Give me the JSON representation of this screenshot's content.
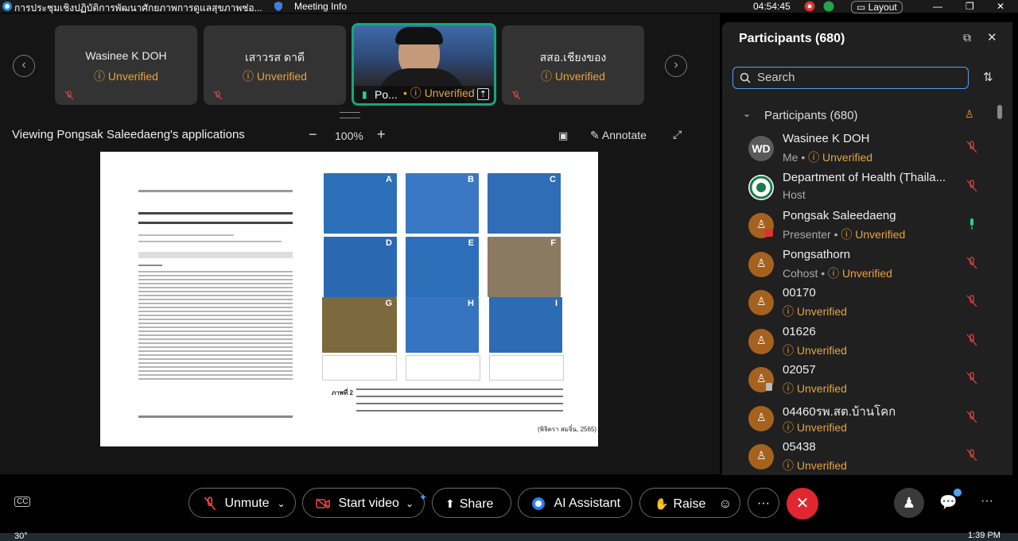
{
  "titlebar": {
    "meeting_title": "การประชุมเชิงปฏิบัติการพัฒนาศักยภาพการดูแลสุขภาพช่อ...",
    "meeting_info": "Meeting Info",
    "time": "04:54:45",
    "layout": "Layout"
  },
  "tiles": [
    {
      "name": "Wasinee K DOH",
      "status": "Unverified"
    },
    {
      "name": "เสาวรส ดาดี",
      "status": "Unverified"
    },
    {
      "name": "Po...",
      "status": "Unverified"
    },
    {
      "name": "สสอ.เชียงของ",
      "status": "Unverified"
    }
  ],
  "share": {
    "viewing": "Viewing Pongsak Saleedaeng's applications",
    "zoom": "100%",
    "annotate": "Annotate"
  },
  "doc": {
    "picture_labels": [
      "A",
      "B",
      "C",
      "D",
      "E",
      "F",
      "G",
      "H",
      "I"
    ],
    "caption_bottom": "(พิจิตรา สมจิ๋น, 2565)",
    "figure_label": "ภาพที่ 2"
  },
  "panel": {
    "title": "Participants (680)",
    "search_placeholder": "Search",
    "section": "Participants (680)",
    "participants": [
      {
        "name": "Wasinee K DOH",
        "role": "Me",
        "status": "Unverified",
        "avatar": "WD"
      },
      {
        "name": "Department of Health (Thaila...",
        "role": "Host",
        "status": "",
        "avatar": ""
      },
      {
        "name": "Pongsak Saleedaeng",
        "role": "Presenter",
        "status": "Unverified",
        "avatar": ""
      },
      {
        "name": "Pongsathorn",
        "role": "Cohost",
        "status": "Unverified",
        "avatar": ""
      },
      {
        "name": "00170",
        "role": "",
        "status": "Unverified",
        "avatar": ""
      },
      {
        "name": "01626",
        "role": "",
        "status": "Unverified",
        "avatar": ""
      },
      {
        "name": "02057",
        "role": "",
        "status": "Unverified",
        "avatar": ""
      },
      {
        "name": "04460รพ.สต.บ้านโคก",
        "role": "",
        "status": "Unverified",
        "avatar": ""
      },
      {
        "name": "05438",
        "role": "",
        "status": "Unverified",
        "avatar": ""
      }
    ]
  },
  "controls": {
    "unmute": "Unmute",
    "start_video": "Start video",
    "share": "Share",
    "ai_assistant": "AI Assistant",
    "raise": "Raise",
    "more": "···"
  },
  "taskbar": {
    "temp": "30°",
    "clock": "1:39 PM"
  },
  "colors": {
    "unverified": "#e8a33b",
    "end_call": "#e0262e",
    "active_border": "#18a67a"
  }
}
